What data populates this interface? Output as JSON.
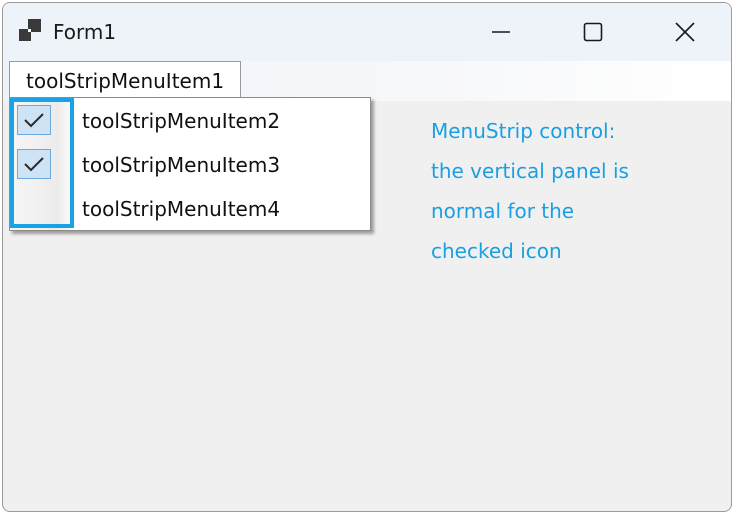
{
  "window": {
    "title": "Form1",
    "app_icon": "form-app-icon",
    "caption_buttons": {
      "minimize_icon": "minimize-icon",
      "maximize_icon": "maximize-icon",
      "close_icon": "close-icon"
    }
  },
  "menu": {
    "top_item_label": "toolStripMenuItem1",
    "items": [
      {
        "label": "toolStripMenuItem2",
        "checked": true,
        "icon": "checkmark-icon"
      },
      {
        "label": "toolStripMenuItem3",
        "checked": true,
        "icon": "checkmark-icon"
      },
      {
        "label": "toolStripMenuItem4",
        "checked": false
      }
    ]
  },
  "annotation": {
    "lines": [
      "MenuStrip control:",
      "the vertical panel is",
      "normal for the",
      "checked icon"
    ]
  },
  "colors": {
    "annotation_text": "#1aa0e2",
    "highlight_border": "#19a3e6",
    "check_fill": "#cfe3f7",
    "check_border": "#6fa9dc",
    "form_background": "#f0f0f0"
  }
}
